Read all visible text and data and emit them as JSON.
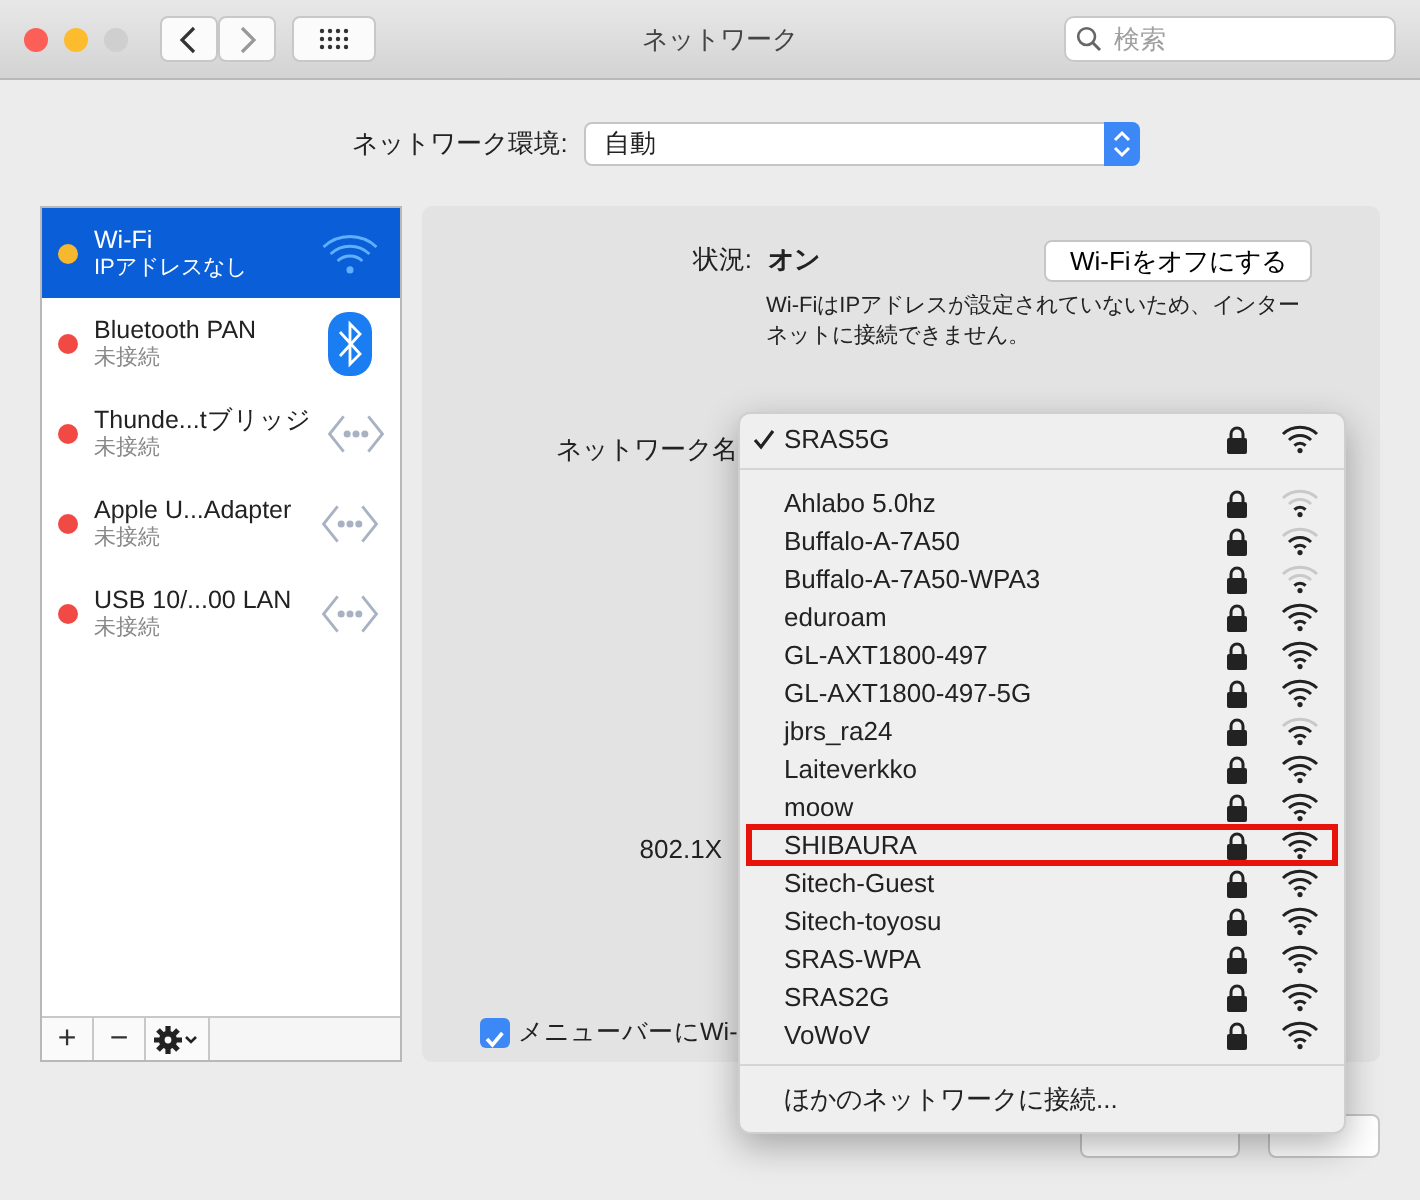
{
  "window": {
    "title": "ネットワーク",
    "search": {
      "placeholder": "検索"
    }
  },
  "location": {
    "label": "ネットワーク環境:",
    "value": "自動"
  },
  "services": [
    {
      "name": "Wi-Fi",
      "status": "IPアドレスなし",
      "color": "#f5b82e",
      "kind": "wifi",
      "selected": true
    },
    {
      "name": "Bluetooth PAN",
      "status": "未接続",
      "color": "#f14a44",
      "kind": "bluetooth",
      "selected": false
    },
    {
      "name": "Thunde...tブリッジ",
      "status": "未接続",
      "color": "#f14a44",
      "kind": "ethernet",
      "selected": false
    },
    {
      "name": "Apple U...Adapter",
      "status": "未接続",
      "color": "#f14a44",
      "kind": "ethernet",
      "selected": false
    },
    {
      "name": "USB 10/...00 LAN",
      "status": "未接続",
      "color": "#f14a44",
      "kind": "ethernet",
      "selected": false
    }
  ],
  "list_toolbar": [
    "+",
    "−"
  ],
  "detail": {
    "status_label": "状況:",
    "status_value": "オン",
    "toggle_button": "Wi-Fiをオフにする",
    "description": "Wi-FiはIPアドレスが設定されていないため、インターネットに接続できません。",
    "network_name_label": "ネットワーク名",
    "dot1x_label": "802.1X",
    "menubar_checkbox": {
      "label": "メニューバーにWi-",
      "checked": true
    }
  },
  "buttons": [
    {
      "kind": "revert"
    },
    {
      "kind": "apply"
    }
  ],
  "network_menu": {
    "current": {
      "name": "SRAS5G",
      "checked": true,
      "kind": "full"
    },
    "networks": [
      {
        "name": "Ahlabo 5.0hz",
        "kind": "low",
        "highlighted": false
      },
      {
        "name": "Buffalo-A-7A50",
        "kind": "medium",
        "highlighted": false
      },
      {
        "name": "Buffalo-A-7A50-WPA3",
        "kind": "low",
        "highlighted": false
      },
      {
        "name": "eduroam",
        "kind": "full",
        "highlighted": false
      },
      {
        "name": "GL-AXT1800-497",
        "kind": "full",
        "highlighted": false
      },
      {
        "name": "GL-AXT1800-497-5G",
        "kind": "full",
        "highlighted": false
      },
      {
        "name": "jbrs_ra24",
        "kind": "medium",
        "highlighted": false
      },
      {
        "name": "Laiteverkko",
        "kind": "full",
        "highlighted": false
      },
      {
        "name": "moow",
        "kind": "full",
        "highlighted": false
      },
      {
        "name": "SHIBAURA",
        "kind": "full",
        "highlighted": true
      },
      {
        "name": "Sitech-Guest",
        "kind": "full",
        "highlighted": false
      },
      {
        "name": "Sitech-toyosu",
        "kind": "full",
        "highlighted": false
      },
      {
        "name": "SRAS-WPA",
        "kind": "full",
        "highlighted": false
      },
      {
        "name": "SRAS2G",
        "kind": "full",
        "highlighted": false
      },
      {
        "name": "VoWoV",
        "kind": "full",
        "highlighted": false
      }
    ],
    "other": "ほかのネットワークに接続..."
  }
}
